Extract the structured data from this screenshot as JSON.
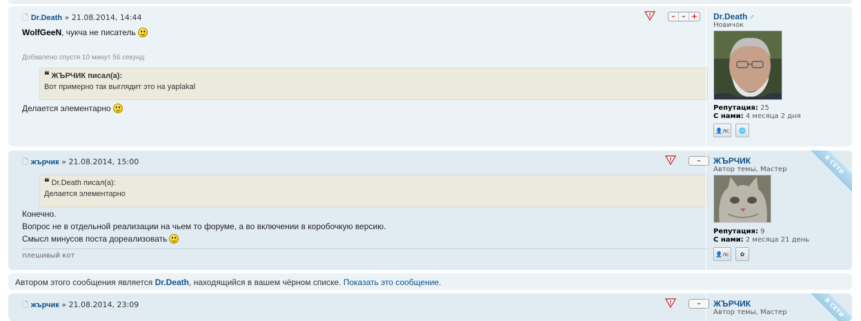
{
  "posts": [
    {
      "author": "Dr.Death",
      "sep": " » ",
      "date": "21.08.2014, 14:44",
      "line1_name": "WolfGeeN",
      "line1_text": ", чукча не писатель",
      "added": "Добавлено спустя 10 минут 56 секунд:",
      "quote_author": "ЖЪРЧИК писал(а):",
      "quote_text": "Вот примерно так выглядит это на yaplakal",
      "after_text": "Делается элементарно",
      "profile": {
        "name": "Dr.Death",
        "gender_icon": "♂",
        "rank": "Новичок",
        "rep_label": "Репутация:",
        "rep_value": "25",
        "since_label": "С нами:",
        "since_value": "4 месяца 2 дня",
        "pm_label": "лс"
      }
    },
    {
      "author": "жърчик",
      "sep": " » ",
      "date": "21.08.2014, 15:00",
      "quote_author": "Dr.Death писал(а):",
      "quote_text": "Делается элементарно",
      "line1": "Конечно.",
      "line2": "Вопрос не в отдельной реализации на чьем то форуме, а во включении в коробочкую версию.",
      "line3": "Смысл минусов поста дореализовать",
      "signature": "плешивый кот",
      "profile": {
        "name": "ЖЪРЧИК",
        "rank": "Автор темы, Мастер",
        "rep_label": "Репутация:",
        "rep_value": "9",
        "since_label": "С нами:",
        "since_value": "2 месяца 21 день",
        "pm_label": "лс",
        "online": "В СЕТИ"
      }
    },
    {
      "author": "жърчик",
      "sep": " » ",
      "date": "21.08.2014, 23:09",
      "profile": {
        "name": "ЖЪРЧИК",
        "rank": "Автор темы, Мастер",
        "online": "В СЕТИ"
      }
    }
  ],
  "ignored": {
    "prefix": "Автором этого сообщения является ",
    "user": "Dr.Death",
    "middle": ", находящийся в вашем чёрном списке. ",
    "link": "Показать это сообщение",
    "suffix": "."
  },
  "buttons": {
    "report": "!",
    "minus": "–",
    "neutral": "–",
    "plus": "+"
  },
  "colors": {
    "link": "#105289",
    "post_bg_light": "#ecf3f7",
    "post_bg_dark": "#e1ebf2",
    "quote_bg": "#ebeadd"
  }
}
